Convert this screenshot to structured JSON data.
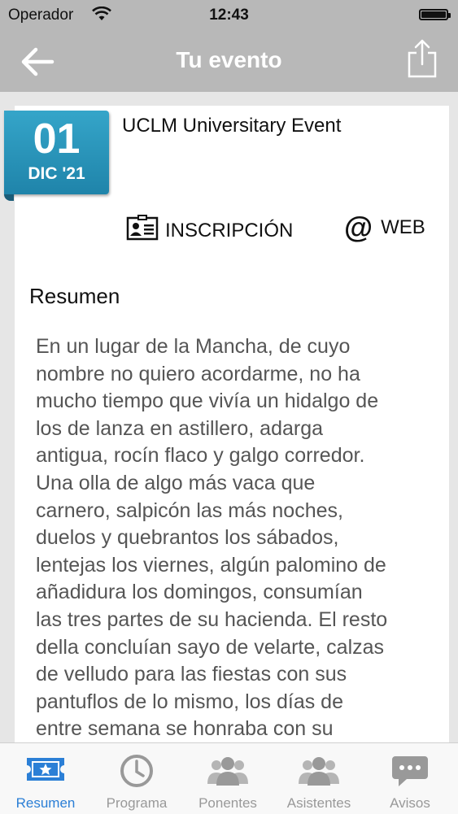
{
  "status_bar": {
    "carrier": "Operador",
    "time": "12:43"
  },
  "nav": {
    "title": "Tu evento",
    "back_icon": "back-arrow-icon",
    "share_icon": "share-icon"
  },
  "event": {
    "day": "01",
    "month_year": "DIC '21",
    "title": "UCLM Universitary Event",
    "registration_label": "INSCRIPCIÓN",
    "web_label": "WEB",
    "web_symbol": "@"
  },
  "summary": {
    "heading": "Resumen",
    "lines": [
      "En un lugar de la Mancha, de cuyo",
      "nombre no quiero acordarme, no ha",
      "mucho tiempo que vivía un hidalgo de",
      "los de lanza en astillero, adarga",
      "antigua, rocín flaco y galgo corredor.",
      "Una olla de algo más vaca que",
      "carnero, salpicón las más noches,",
      "duelos y quebrantos los sábados,",
      "lentejas los viernes, algún palomino de",
      "añadidura los domingos, consumían",
      "las tres partes de su hacienda. El resto",
      "della concluían sayo de velarte, calzas",
      "de velludo para las fiestas con sus",
      "pantuflos de lo mismo, los días de",
      "entre semana se honraba con su"
    ]
  },
  "tabs": [
    {
      "label": "Resumen",
      "icon": "ticket-icon",
      "active": true
    },
    {
      "label": "Programa",
      "icon": "clock-icon",
      "active": false
    },
    {
      "label": "Ponentes",
      "icon": "people-icon",
      "active": false
    },
    {
      "label": "Asistentes",
      "icon": "people-icon",
      "active": false
    },
    {
      "label": "Avisos",
      "icon": "chat-bubble-icon",
      "active": false
    }
  ],
  "colors": {
    "bar_gray": "#b8b8b8",
    "badge_blue": "#2a96bd",
    "tab_active": "#2b7fd6",
    "tab_inactive": "#999999"
  }
}
